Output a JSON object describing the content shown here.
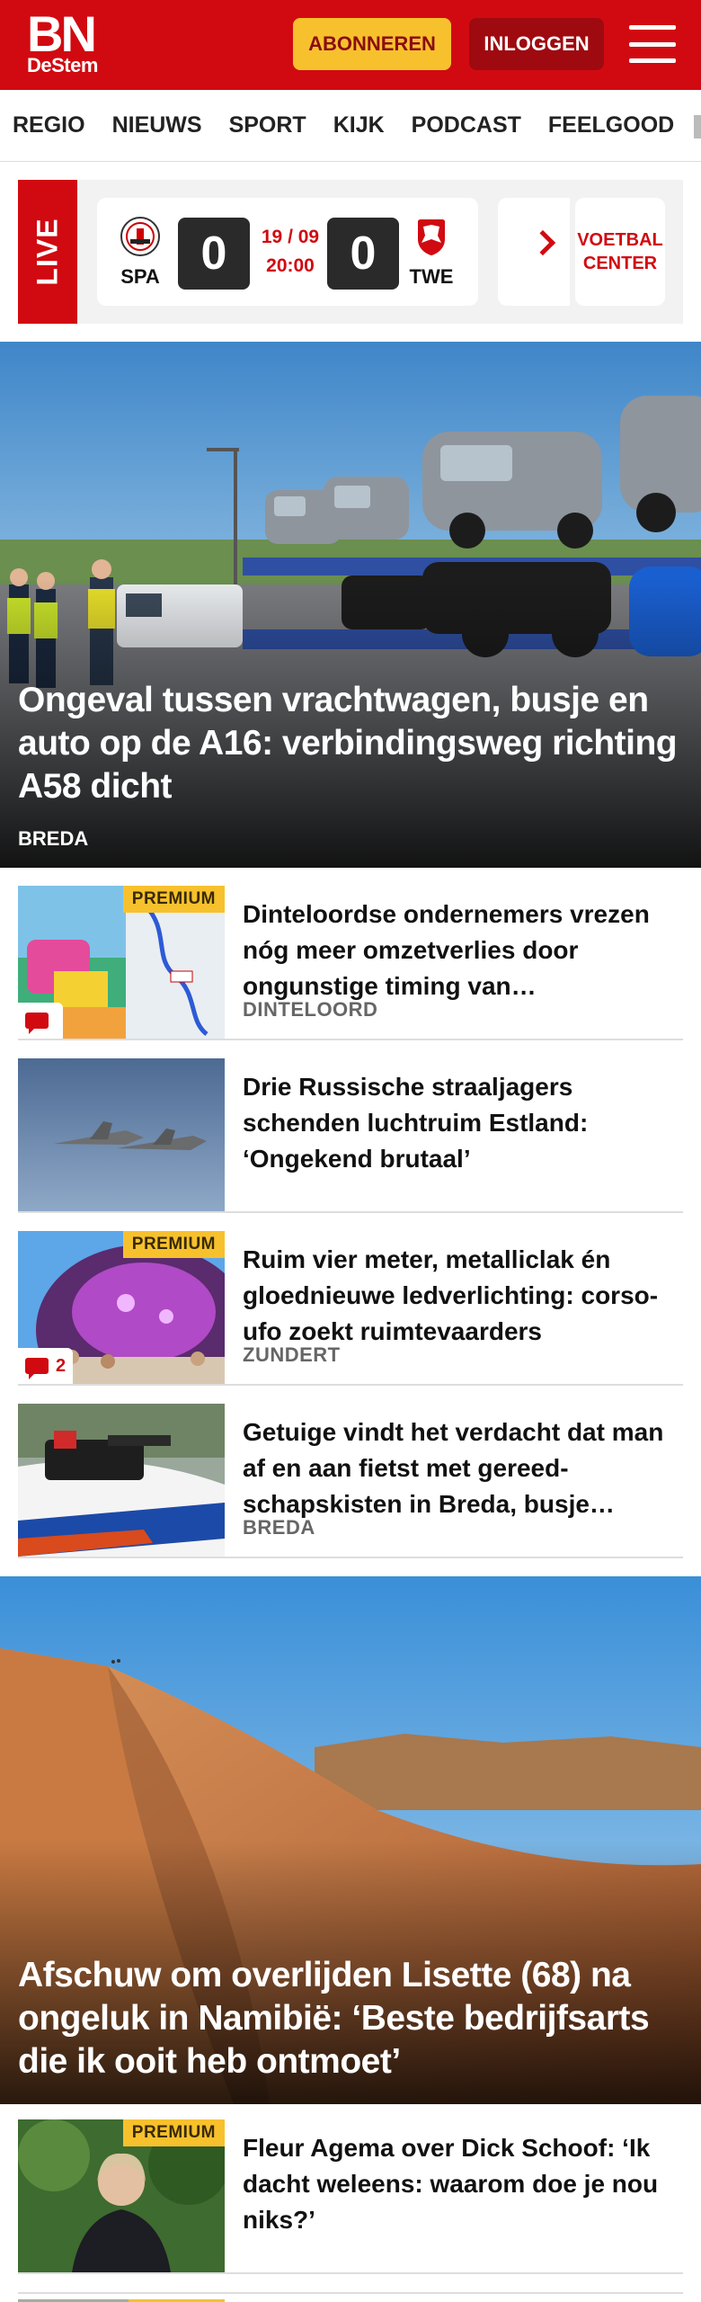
{
  "header": {
    "logo_main": "BN",
    "logo_sub": "DeStem",
    "subscribe_label": "ABONNEREN",
    "login_label": "INLOGGEN"
  },
  "nav": {
    "items": [
      "REGIO",
      "NIEUWS",
      "SPORT",
      "KIJK",
      "PODCAST",
      "FEELGOOD"
    ]
  },
  "live": {
    "label": "LIVE",
    "match": {
      "home_code": "SPA",
      "away_code": "TWE",
      "home_score": "0",
      "away_score": "0",
      "date": "19 / 09",
      "time": "20:00"
    },
    "voetbal_center_label": "VOETBAL CENTER"
  },
  "hero1": {
    "title": "Ongeval tussen vrachtwagen, busje en auto op de A16: verbindingsweg richting A58 dicht",
    "location": "BREDA"
  },
  "articles_a": [
    {
      "headline": "Dinteloordse ondernemers vrezen nóg meer omzetverlies door ongunstige timing van…",
      "location": "DINTELOORD",
      "premium": true,
      "comments": ""
    },
    {
      "headline": "Drie Russische straaljagers schenden luchtruim Estland: ‘Ongekend brutaal’",
      "location": "",
      "premium": false,
      "comments": ""
    },
    {
      "headline": "Ruim vier meter, metalliclak én gloednieuwe ledverlichting: corso-ufo zoekt ruimtevaarders",
      "location": "ZUNDERT",
      "premium": true,
      "comments": "2"
    },
    {
      "headline": "Getuige vindt het verdacht dat man af en aan fietst met gereed­schapskisten in Breda, busje…",
      "location": "BREDA",
      "premium": false,
      "comments": ""
    }
  ],
  "hero2": {
    "title": "Afschuw om overlijden Lisette (68) na ongeluk in Namibië: ‘Beste bedrijfs­arts die ik ooit heb ontmoet’",
    "location": ""
  },
  "articles_b": [
    {
      "headline": "Fleur Agema over Dick Schoof: ‘Ik dacht weleens: waarom doe je nou niks?’",
      "location": "",
      "premium": true,
      "comments": ""
    }
  ],
  "badges": {
    "premium_label": "PREMIUM"
  },
  "colors": {
    "brand_red": "#d10a11",
    "premium_yellow": "#f7c12d",
    "dark_red": "#9e0a10"
  }
}
